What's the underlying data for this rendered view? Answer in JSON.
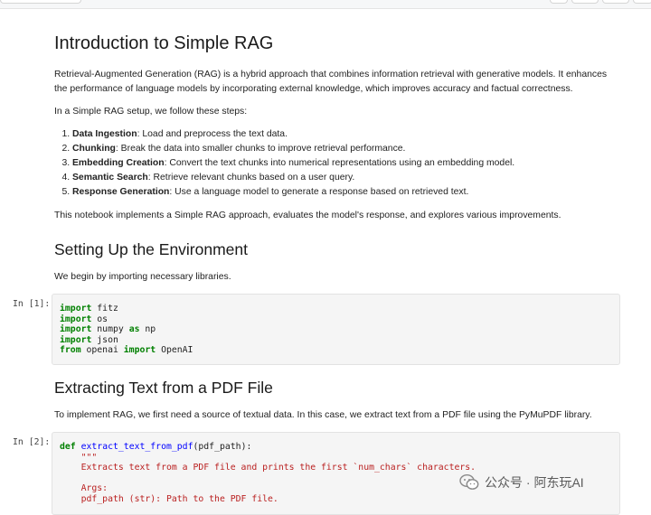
{
  "intro": {
    "title": "Introduction to Simple RAG",
    "para1_line1": "Retrieval-Augmented Generation (RAG) is a hybrid approach that combines information retrieval with generative models. It enhances",
    "para1_line2": "the performance of language models by incorporating external knowledge, which improves accuracy and factual correctness.",
    "para2": "In a Simple RAG setup, we follow these steps:",
    "steps": [
      {
        "bold": "Data Ingestion",
        "text": ": Load and preprocess the text data."
      },
      {
        "bold": "Chunking",
        "text": ": Break the data into smaller chunks to improve retrieval performance."
      },
      {
        "bold": "Embedding Creation",
        "text": ": Convert the text chunks into numerical representations using an embedding model."
      },
      {
        "bold": "Semantic Search",
        "text": ": Retrieve relevant chunks based on a user query."
      },
      {
        "bold": "Response Generation",
        "text": ": Use a language model to generate a response based on retrieved text."
      }
    ],
    "para3": "This notebook implements a Simple RAG approach, evaluates the model's response, and explores various improvements."
  },
  "section_env": {
    "title": "Setting Up the Environment",
    "para": "We begin by importing necessary libraries."
  },
  "cell1": {
    "prompt": "In [1]:",
    "lines": [
      [
        {
          "k": "import",
          "t": "kw"
        },
        {
          "k": " fitz",
          "t": ""
        }
      ],
      [
        {
          "k": "import",
          "t": "kw"
        },
        {
          "k": " os",
          "t": ""
        }
      ],
      [
        {
          "k": "import",
          "t": "kw"
        },
        {
          "k": " numpy ",
          "t": ""
        },
        {
          "k": "as",
          "t": "kw"
        },
        {
          "k": " np",
          "t": ""
        }
      ],
      [
        {
          "k": "import",
          "t": "kw"
        },
        {
          "k": " json",
          "t": ""
        }
      ],
      [
        {
          "k": "from",
          "t": "kw"
        },
        {
          "k": " openai ",
          "t": ""
        },
        {
          "k": "import",
          "t": "kw"
        },
        {
          "k": " OpenAI",
          "t": ""
        }
      ]
    ]
  },
  "section_pdf": {
    "title": "Extracting Text from a PDF File",
    "para": "To implement RAG, we first need a source of textual data. In this case, we extract text from a PDF file using the PyMuPDF library."
  },
  "cell2": {
    "prompt": "In [2]:",
    "lines": [
      [
        {
          "k": "def",
          "t": "kw"
        },
        {
          "k": " ",
          "t": ""
        },
        {
          "k": "extract_text_from_pdf",
          "t": "fn"
        },
        {
          "k": "(pdf_path):",
          "t": ""
        }
      ],
      [
        {
          "k": "    \"\"\"",
          "t": "str"
        }
      ],
      [
        {
          "k": "    Extracts text from a PDF file and prints the first `num_chars` characters.",
          "t": "str"
        }
      ],
      [
        {
          "k": "",
          "t": ""
        }
      ],
      [
        {
          "k": "    Args:",
          "t": "str"
        }
      ],
      [
        {
          "k": "    pdf_path (str): Path to the PDF file.",
          "t": "str"
        }
      ]
    ]
  },
  "watermark": {
    "text": "公众号 · 阿东玩AI",
    "icon": "wechat-icon"
  },
  "colors": {
    "keyword": "#008000",
    "string": "#ba2121",
    "function": "#0000ff",
    "cell_bg": "#f5f5f5"
  }
}
